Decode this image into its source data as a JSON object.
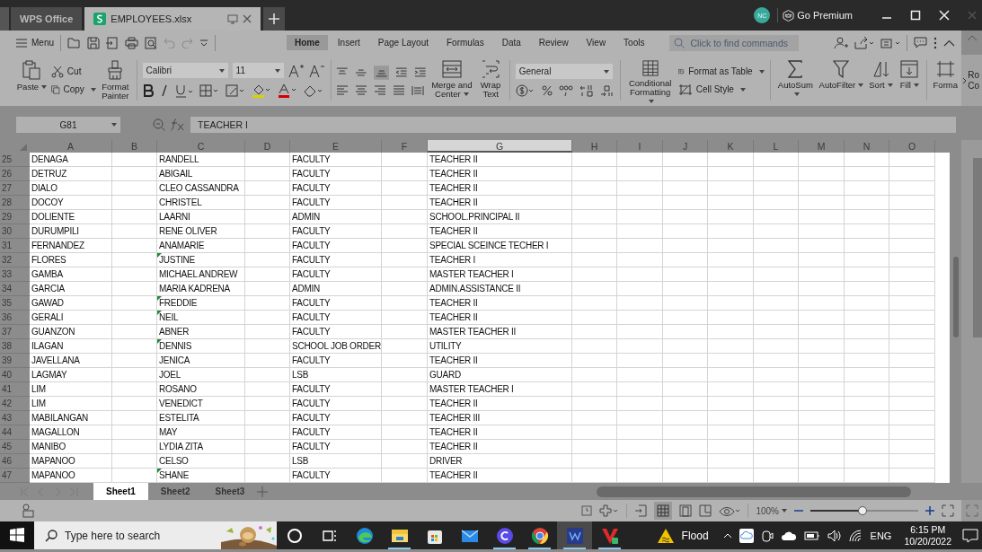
{
  "tabs": [
    {
      "label": "WPS Office",
      "selected": false
    },
    {
      "label": "EMPLOYEES.xlsx",
      "selected": true
    }
  ],
  "account": {
    "initials": "NC",
    "premium": "Go Premium"
  },
  "menu_button": "Menu",
  "menu_tabs": [
    {
      "label": "Home",
      "selected": true
    },
    {
      "label": "Insert",
      "selected": false
    },
    {
      "label": "Page Layout",
      "selected": false
    },
    {
      "label": "Formulas",
      "selected": false
    },
    {
      "label": "Data",
      "selected": false
    },
    {
      "label": "Review",
      "selected": false
    },
    {
      "label": "View",
      "selected": false
    },
    {
      "label": "Tools",
      "selected": false
    }
  ],
  "search": {
    "placeholder": "Click to find commands"
  },
  "ribbon": {
    "paste": "Paste",
    "cut": "Cut",
    "copy": "Copy",
    "format_painter": "Format Painter",
    "font": "Calibri",
    "size": "11",
    "merge": "Merge and Center",
    "wrap": "Wrap Text",
    "number_format": "General",
    "conditional": "Conditional Formatting",
    "format_table": "Format as Table",
    "cell_style": "Cell Style",
    "autosum": "AutoSum",
    "autofilter": "AutoFilter",
    "sort": "Sort",
    "fill": "Fill",
    "format": "Forma",
    "overflow": [
      "Ro",
      "Co"
    ]
  },
  "name_box": "G81",
  "formula": "TEACHER I",
  "columns": [
    {
      "label": "A",
      "selected": false
    },
    {
      "label": "B",
      "selected": false
    },
    {
      "label": "C",
      "selected": false
    },
    {
      "label": "D",
      "selected": false
    },
    {
      "label": "E",
      "selected": false
    },
    {
      "label": "F",
      "selected": false
    },
    {
      "label": "G",
      "selected": true
    },
    {
      "label": "H",
      "selected": false
    },
    {
      "label": "I",
      "selected": false
    },
    {
      "label": "J",
      "selected": false
    },
    {
      "label": "K",
      "selected": false
    },
    {
      "label": "L",
      "selected": false
    },
    {
      "label": "M",
      "selected": false
    },
    {
      "label": "N",
      "selected": false
    },
    {
      "label": "O",
      "selected": false
    }
  ],
  "rows": [
    {
      "number": "25",
      "a": "DENAGA",
      "c": "RANDELL",
      "e": "FACULTY",
      "g": "TEACHER II",
      "flagged": false
    },
    {
      "number": "26",
      "a": "DETRUZ",
      "c": "ABIGAIL",
      "e": "FACULTY",
      "g": "TEACHER II",
      "flagged": false
    },
    {
      "number": "27",
      "a": "DIALO",
      "c": "CLEO CASSANDRA",
      "e": "FACULTY",
      "g": "TEACHER II",
      "flagged": false
    },
    {
      "number": "28",
      "a": "DOCOY",
      "c": "CHRISTEL",
      "e": "FACULTY",
      "g": "TEACHER II",
      "flagged": false
    },
    {
      "number": "29",
      "a": "DOLIENTE",
      "c": "LAARNI",
      "e": "ADMIN",
      "g": "SCHOOL.PRINCIPAL II",
      "flagged": false
    },
    {
      "number": "30",
      "a": "DURUMPILI",
      "c": "RENE OLIVER",
      "e": "FACULTY",
      "g": "TEACHER II",
      "flagged": false
    },
    {
      "number": "31",
      "a": "FERNANDEZ",
      "c": "ANAMARIE",
      "e": "FACULTY",
      "g": "SPECIAL SCEINCE TECHER I",
      "flagged": false
    },
    {
      "number": "32",
      "a": "FLORES",
      "c": "JUSTINE",
      "e": "FACULTY",
      "g": "TEACHER I",
      "flagged": true
    },
    {
      "number": "33",
      "a": "GAMBA",
      "c": "MICHAEL ANDREW",
      "e": "FACULTY",
      "g": "MASTER TEACHER I",
      "flagged": false
    },
    {
      "number": "34",
      "a": "GARCIA",
      "c": "MARIA KADRENA",
      "e": "ADMIN",
      "g": "ADMIN.ASSISTANCE II",
      "flagged": false
    },
    {
      "number": "35",
      "a": "GAWAD",
      "c": "FREDDIE",
      "e": "FACULTY",
      "g": "TEACHER II",
      "flagged": true
    },
    {
      "number": "36",
      "a": "GERALI",
      "c": "NEIL",
      "e": "FACULTY",
      "g": "TEACHER II",
      "flagged": true
    },
    {
      "number": "37",
      "a": "GUANZON",
      "c": "ABNER",
      "e": "FACULTY",
      "g": "MASTER TEACHER II",
      "flagged": false
    },
    {
      "number": "38",
      "a": "ILAGAN",
      "c": "DENNIS",
      "e": "SCHOOL JOB ORDER",
      "g": "UTILITY",
      "flagged": true
    },
    {
      "number": "39",
      "a": "JAVELLANA",
      "c": "JENICA",
      "e": "FACULTY",
      "g": "TEACHER II",
      "flagged": false
    },
    {
      "number": "40",
      "a": "LAGMAY",
      "c": "JOEL",
      "e": "LSB",
      "g": "GUARD",
      "flagged": false
    },
    {
      "number": "41",
      "a": "LIM",
      "c": "ROSANO",
      "e": "FACULTY",
      "g": "MASTER TEACHER I",
      "flagged": false
    },
    {
      "number": "42",
      "a": "LIM",
      "c": "VENEDICT",
      "e": "FACULTY",
      "g": "TEACHER II",
      "flagged": false
    },
    {
      "number": "43",
      "a": "MABILANGAN",
      "c": "ESTELITA",
      "e": "FACULTY",
      "g": "TEACHER III",
      "flagged": false
    },
    {
      "number": "44",
      "a": "MAGALLON",
      "c": "MAY",
      "e": "FACULTY",
      "g": "TEACHER II",
      "flagged": false
    },
    {
      "number": "45",
      "a": "MANIBO",
      "c": "LYDIA ZITA",
      "e": "FACULTY",
      "g": "TEACHER II",
      "flagged": false
    },
    {
      "number": "46",
      "a": "MAPANOO",
      "c": "CELSO",
      "e": "LSB",
      "g": "DRIVER",
      "flagged": false
    },
    {
      "number": "47",
      "a": "MAPANOO",
      "c": "SHANE",
      "e": "FACULTY",
      "g": "TEACHER II",
      "flagged": true
    }
  ],
  "sheets": [
    {
      "label": "Sheet1",
      "selected": true
    },
    {
      "label": "Sheet2",
      "selected": false
    },
    {
      "label": "Sheet3",
      "selected": false
    }
  ],
  "zoom": {
    "label": "100%",
    "level": 0.48
  },
  "taskbar": {
    "search_placeholder": "Type here to search",
    "apps": [
      {
        "running": false,
        "selected": false
      },
      {
        "running": false,
        "selected": false
      },
      {
        "running": false,
        "selected": false
      },
      {
        "running": true,
        "selected": false
      },
      {
        "running": false,
        "selected": false
      },
      {
        "running": false,
        "selected": false
      },
      {
        "running": true,
        "selected": false
      },
      {
        "running": true,
        "selected": false
      },
      {
        "running": true,
        "selected": true
      },
      {
        "running": true,
        "selected": false
      }
    ],
    "weather": "Flood",
    "language": "ENG",
    "time": "6:15 PM",
    "date": "10/20/2022"
  }
}
